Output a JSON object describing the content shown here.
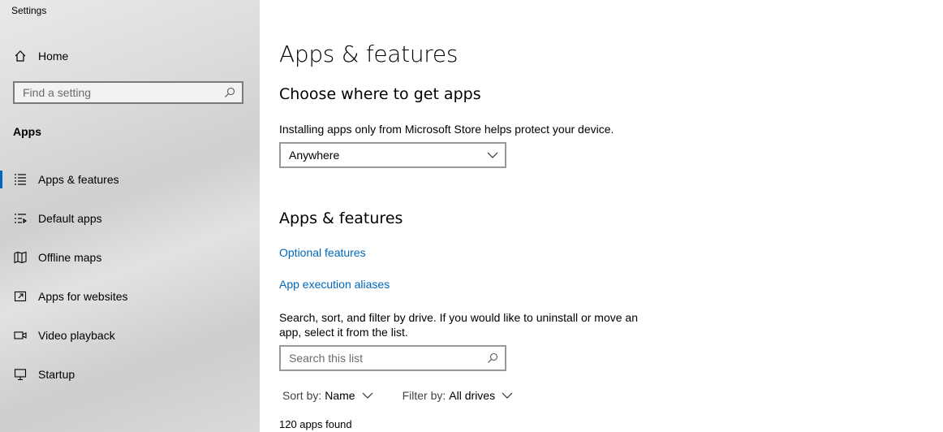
{
  "window": {
    "title": "Settings"
  },
  "sidebar": {
    "home_label": "Home",
    "search_placeholder": "Find a setting",
    "section_label": "Apps",
    "items": [
      {
        "label": "Apps & features",
        "icon": "list-icon",
        "selected": true
      },
      {
        "label": "Default apps",
        "icon": "default-apps-icon"
      },
      {
        "label": "Offline maps",
        "icon": "map-icon"
      },
      {
        "label": "Apps for websites",
        "icon": "open-in-icon"
      },
      {
        "label": "Video playback",
        "icon": "video-icon"
      },
      {
        "label": "Startup",
        "icon": "startup-icon"
      }
    ]
  },
  "main": {
    "page_title": "Apps & features",
    "choose_heading": "Choose where to get apps",
    "choose_desc": "Installing apps only from Microsoft Store helps protect your device.",
    "source_dropdown_value": "Anywhere",
    "features_heading": "Apps & features",
    "optional_features_link": "Optional features",
    "aliases_link": "App execution aliases",
    "search_desc_line1": "Search, sort, and filter by drive. If you would like to uninstall or move an",
    "search_desc_line2": "app, select it from the list.",
    "search_placeholder": "Search this list",
    "sort_label": "Sort by:",
    "sort_value": "Name",
    "filter_label": "Filter by:",
    "filter_value": "All drives",
    "apps_count": "120 apps found"
  },
  "colors": {
    "accent": "#0067c0",
    "link": "#0067b8"
  }
}
